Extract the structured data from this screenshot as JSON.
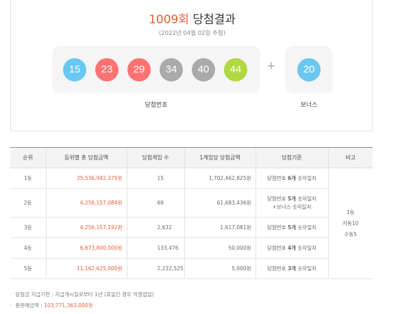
{
  "header": {
    "round": "1009회",
    "title_suffix": "당첨결과",
    "draw_date": "(2022년 04월 02일 추첨)"
  },
  "winning_numbers": [
    {
      "value": "15",
      "color": "#69c8f2"
    },
    {
      "value": "23",
      "color": "#ff7272"
    },
    {
      "value": "29",
      "color": "#ff7272"
    },
    {
      "value": "34",
      "color": "#aaaaaa"
    },
    {
      "value": "40",
      "color": "#aaaaaa"
    },
    {
      "value": "44",
      "color": "#b0d840"
    }
  ],
  "plus_sign": "+",
  "bonus": {
    "value": "20",
    "color": "#69c8f2"
  },
  "labels": {
    "winning": "당첨번호",
    "bonus": "보너스"
  },
  "table": {
    "headers": [
      "순위",
      "등위별 총 당첨금액",
      "당첨게임 수",
      "1게임당 당첨금액",
      "당첨기준",
      "비고"
    ],
    "rows": [
      {
        "rank": "1등",
        "total": "25,536,942,375원",
        "count": "15",
        "per_game": "1,702,462,825원",
        "crit_pre": "당첨번호 ",
        "crit_bold": "6개",
        "crit_post": " 숫자일치",
        "crit2": ""
      },
      {
        "rank": "2등",
        "total": "4,256,157,084원",
        "count": "69",
        "per_game": "61,683,436원",
        "crit_pre": "당첨번호 ",
        "crit_bold": "5개",
        "crit_post": " 숫자일치",
        "crit2": "+보너스 숫자일치"
      },
      {
        "rank": "3등",
        "total": "4,256,157,192원",
        "count": "2,632",
        "per_game": "1,617,081원",
        "crit_pre": "당첨번호 ",
        "crit_bold": "5개",
        "crit_post": " 숫자일치",
        "crit2": ""
      },
      {
        "rank": "4등",
        "total": "6,673,800,000원",
        "count": "133,476",
        "per_game": "50,000원",
        "crit_pre": "당첨번호 ",
        "crit_bold": "4개",
        "crit_post": " 숫자일치",
        "crit2": ""
      },
      {
        "rank": "5등",
        "total": "11,162,625,000원",
        "count": "2,232,525",
        "per_game": "5,000원",
        "crit_pre": "당첨번호 ",
        "crit_bold": "3개",
        "crit_post": " 숫자일치",
        "crit2": ""
      }
    ],
    "note": [
      "1등",
      "자동10",
      "수동5"
    ]
  },
  "footnotes": {
    "deadline_label": "당첨금 지급기한 : 지급개시일로부터 1년 (휴일인 경우 익영업일)",
    "sales_label": "총판매금액 : ",
    "sales_value": "103,771,363,000원"
  }
}
